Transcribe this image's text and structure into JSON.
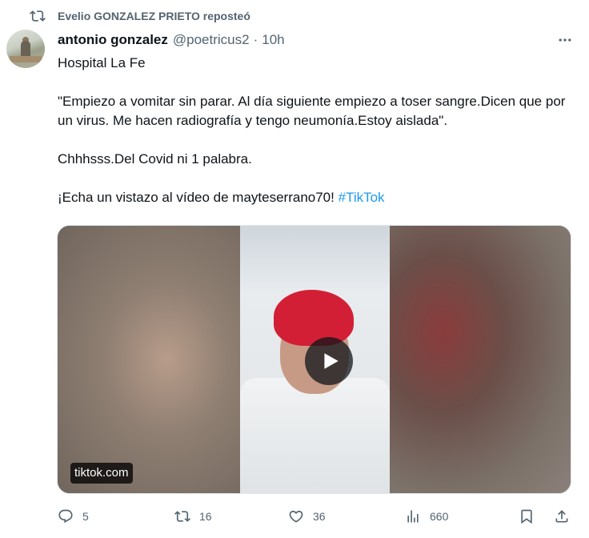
{
  "repost": {
    "text": "Evelio GONZALEZ PRIETO reposteó",
    "icon": "repost-icon"
  },
  "author": {
    "name": "antonio gonzalez",
    "handle": "@poetricus2",
    "separator": "·",
    "time": "10h",
    "avatar_icon": "avatar-image"
  },
  "tweet": {
    "line1": "Hospital La Fe",
    "line2": "\"Empiezo a vomitar sin parar. Al día siguiente empiezo a toser sangre.Dicen que por un virus. Me hacen radiografía y tengo neumonía.Estoy aislada\".",
    "line3": "Chhhsss.Del Covid ni 1 palabra.",
    "line4": "¡Echa un vistazo al vídeo de mayteserrano70!",
    "hashtag": "#TikTok"
  },
  "media": {
    "source": "tiktok.com",
    "play_icon": "play-icon"
  },
  "actions": {
    "reply": {
      "icon": "reply-icon",
      "count": "5"
    },
    "repost": {
      "icon": "repost-icon",
      "count": "16"
    },
    "like": {
      "icon": "like-icon",
      "count": "36"
    },
    "views": {
      "icon": "views-icon",
      "count": "660"
    },
    "bookmark": {
      "icon": "bookmark-icon"
    },
    "share": {
      "icon": "share-icon"
    }
  },
  "colors": {
    "accent": "#1d9bf0",
    "secondary_text": "#536471",
    "primary_text": "#0f1419"
  }
}
